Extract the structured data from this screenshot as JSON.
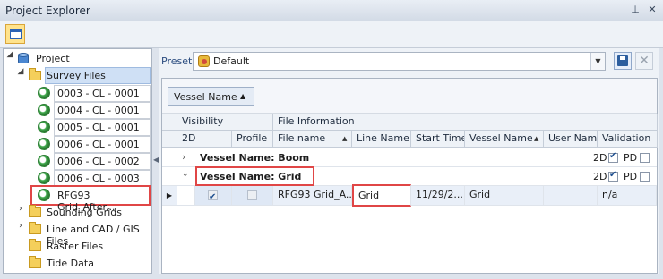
{
  "window": {
    "title": "Project Explorer"
  },
  "tree": {
    "root": "Project",
    "survey_files": "Survey Files",
    "files": [
      "0003 - CL - 0001",
      "0004 - CL - 0001",
      "0005 - CL - 0001",
      "0006 - CL - 0001",
      "0006 - CL - 0002",
      "0006 - CL - 0003",
      "RFG93 Grid_After..."
    ],
    "folders": [
      "Sounding Grids",
      "Line and CAD / GIS Files",
      "Raster Files",
      "Tide Data"
    ]
  },
  "preset": {
    "label": "Preset",
    "value": "Default"
  },
  "grid": {
    "group_by": "Vessel Name",
    "bands": {
      "visibility": "Visibility",
      "file_info": "File Information"
    },
    "columns": {
      "c2d": "2D",
      "profile": "Profile",
      "file_name": "File name",
      "line_name": "Line Name",
      "start_time": "Start Time",
      "vessel_name": "Vessel Name",
      "user_name": "User Name",
      "validation": "Validation"
    },
    "groups": [
      {
        "label": "Vessel Name: Boom",
        "flag2d": "2D",
        "flagpd": "PD"
      },
      {
        "label": "Vessel Name: Grid",
        "flag2d": "2D",
        "flagpd": "PD"
      }
    ],
    "row": {
      "file_name": "RFG93 Grid_A...",
      "line_name": "Grid",
      "start_time": "11/29/2...",
      "vessel_name": "Grid",
      "user_name": "",
      "validation": "n/a"
    }
  },
  "colors": {
    "highlight": "#e04646"
  }
}
